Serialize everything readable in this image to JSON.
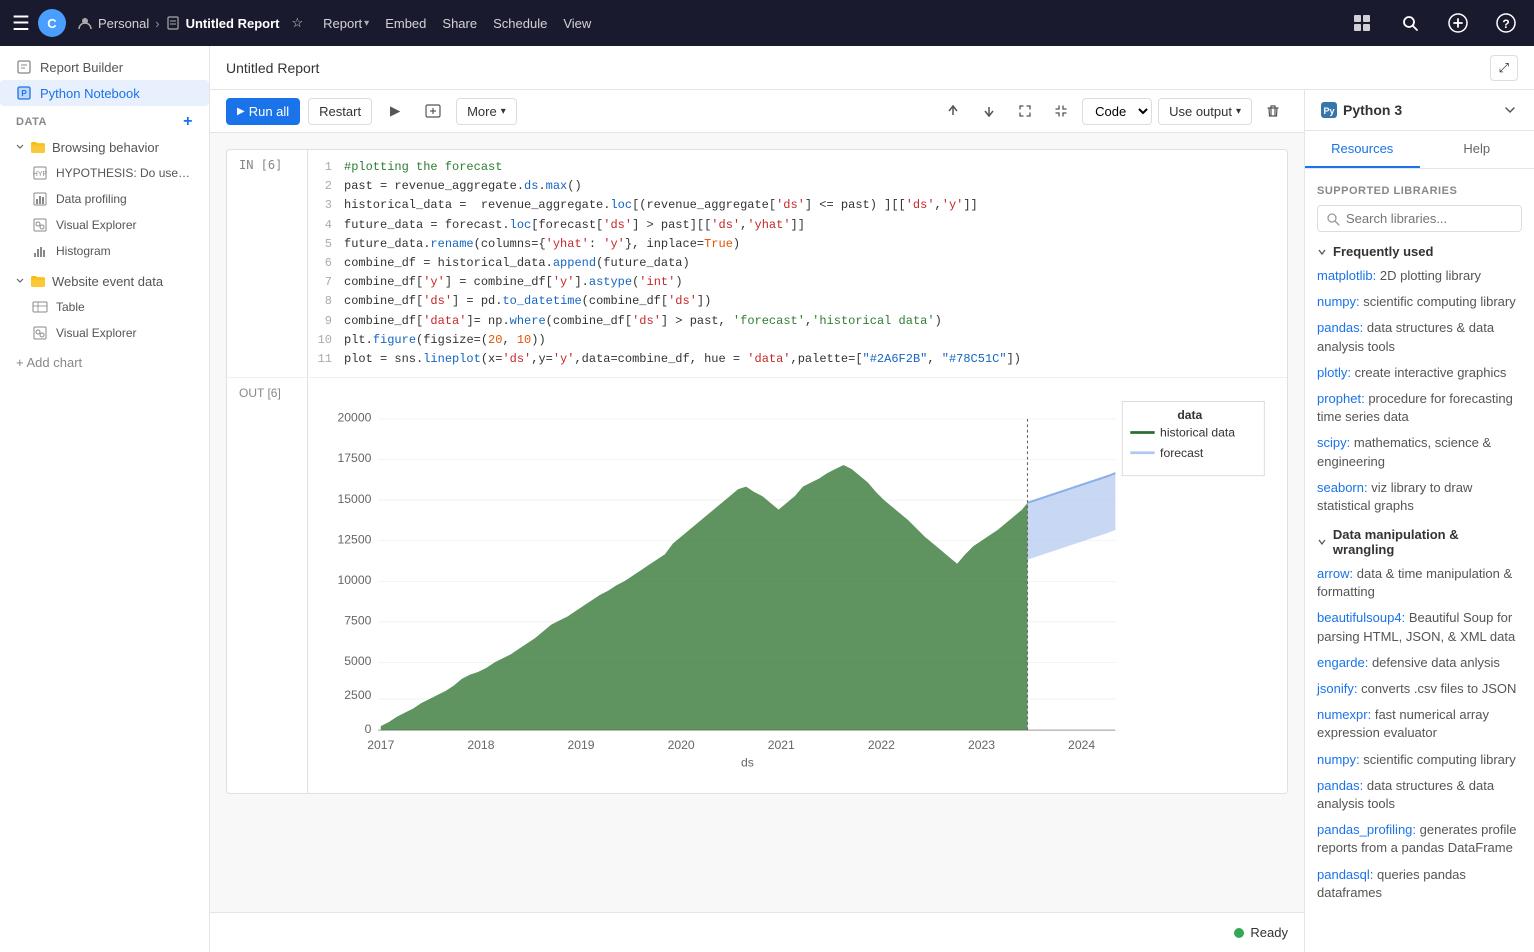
{
  "topbar": {
    "logo": "≡",
    "brand": "C",
    "personal": "Personal",
    "report_name": "Untitled Report",
    "nav": [
      "Report",
      "Embed",
      "Share",
      "Schedule",
      "View"
    ],
    "python_version": "Python 3"
  },
  "second_bar": {
    "page_title": "Untitled Report",
    "expand_label": "⤢"
  },
  "sidebar": {
    "report_builder": "Report Builder",
    "python_notebook": "Python Notebook",
    "data_label": "DATA",
    "groups": [
      {
        "name": "Browsing behavior",
        "children": [
          {
            "label": "HYPOTHESIS: Do users go...",
            "icon": "hypothesis"
          },
          {
            "label": "Data profiling",
            "icon": "data"
          },
          {
            "label": "Visual Explorer",
            "icon": "visual"
          },
          {
            "label": "Histogram",
            "icon": "histogram"
          }
        ]
      },
      {
        "name": "Website event data",
        "children": [
          {
            "label": "Table",
            "icon": "table"
          },
          {
            "label": "Visual Explorer",
            "icon": "visual"
          }
        ]
      }
    ],
    "add_chart": "+ Add chart"
  },
  "toolbar": {
    "run_all": "Run all",
    "restart": "Restart",
    "more": "More",
    "code_label": "Code",
    "use_output": "Use output"
  },
  "cell": {
    "in_label": "IN [6]",
    "out_label": "OUT [6]",
    "code_lines": [
      {
        "num": 1,
        "text": "#plotting the forecast"
      },
      {
        "num": 2,
        "text": "past = revenue_aggregate.ds.max()"
      },
      {
        "num": 3,
        "text": "historical_data =  revenue_aggregate.loc[(revenue_aggregate['ds'] <= past) ][['ds','y']]"
      },
      {
        "num": 4,
        "text": "future_data = forecast.loc[forecast['ds'] > past][['ds','yhat']]"
      },
      {
        "num": 5,
        "text": "future_data.rename(columns={'yhat': 'y'}, inplace=True)"
      },
      {
        "num": 6,
        "text": "combine_df = historical_data.append(future_data)"
      },
      {
        "num": 7,
        "text": "combine_df['y'] = combine_df['y'].astype('int')"
      },
      {
        "num": 8,
        "text": "combine_df['ds'] = pd.to_datetime(combine_df['ds'])"
      },
      {
        "num": 9,
        "text": "combine_df['data']= np.where(combine_df['ds'] > past, 'forecast','historical data')"
      },
      {
        "num": 10,
        "text": "plt.figure(figsize=(20, 10))"
      },
      {
        "num": 11,
        "text": "plot = sns.lineplot(x='ds',y='y',data=combine_df, hue = 'data',palette=[\"#2A6F2B\", \"#78C51C\"])"
      }
    ]
  },
  "chart": {
    "y_labels": [
      "20000",
      "17500",
      "15000",
      "12500",
      "10000",
      "7500",
      "5000",
      "2500",
      "0"
    ],
    "x_labels": [
      "2017",
      "2018",
      "2019",
      "2020",
      "2021",
      "2022",
      "2023",
      "2024"
    ],
    "x_axis_label": "ds",
    "legend": {
      "title": "data",
      "items": [
        "historical data",
        "forecast"
      ]
    },
    "colors": {
      "historical": "#2A6F2B",
      "forecast": "#b0c8f0"
    }
  },
  "status": {
    "ready": "Ready"
  },
  "right_panel": {
    "title": "Python 3",
    "tabs": [
      "Resources",
      "Help"
    ],
    "active_tab": "Resources",
    "supported_libraries": "SUPPORTED LIBRARIES",
    "search_placeholder": "Search libraries...",
    "categories": [
      {
        "name": "Frequently used",
        "expanded": true,
        "libraries": [
          {
            "name": "matplotlib:",
            "desc": "2D plotting library"
          },
          {
            "name": "numpy:",
            "desc": "scientific computing library"
          },
          {
            "name": "pandas:",
            "desc": "data structures & data analysis tools"
          },
          {
            "name": "plotly:",
            "desc": "create interactive graphics"
          },
          {
            "name": "prophet:",
            "desc": "procedure for forecasting time series data"
          },
          {
            "name": "scipy:",
            "desc": "mathematics, science & engineering"
          },
          {
            "name": "seaborn:",
            "desc": "viz library to draw statistical graphs"
          }
        ]
      },
      {
        "name": "Data manipulation & wrangling",
        "expanded": true,
        "libraries": [
          {
            "name": "arrow:",
            "desc": "data & time manipulation & formatting"
          },
          {
            "name": "beautifulsoup4:",
            "desc": "Beautiful Soup for parsing HTML, JSON, & XML data"
          },
          {
            "name": "engarde:",
            "desc": "defensive data anlysis"
          },
          {
            "name": "jsonify:",
            "desc": "converts .csv files to JSON"
          },
          {
            "name": "numexpr:",
            "desc": "fast numerical array expression evaluator"
          },
          {
            "name": "numpy:",
            "desc": "scientific computing library"
          },
          {
            "name": "pandas:",
            "desc": "data structures & data analysis tools"
          },
          {
            "name": "pandas_profiling:",
            "desc": "generates profile reports from a pandas DataFrame"
          },
          {
            "name": "pandasql:",
            "desc": "queries pandas dataframes"
          }
        ]
      }
    ]
  }
}
